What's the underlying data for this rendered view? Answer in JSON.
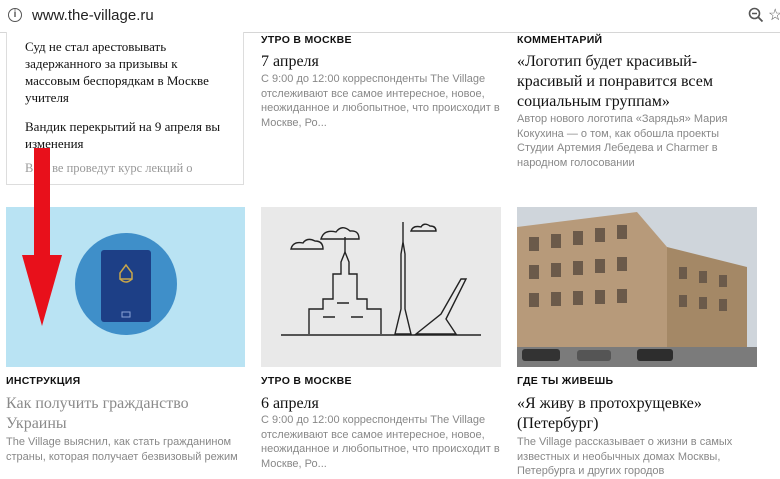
{
  "browser": {
    "url": "www.the-village.ru"
  },
  "news_list": {
    "items": [
      "Суд не стал арестовывать задержанного за призывы к массовым беспорядкам в Москве учителя",
      "Вандик перекрытий на 9 апреля вы изменения",
      "В … ве проведут курс лекций о"
    ]
  },
  "cards": [
    {
      "category": "УТРО В МОСКВЕ",
      "title": "7 апреля",
      "desc": "С 9:00 до 12:00 корреспонденты The Village отслеживают все самое интересное, новое, неожиданное и любопытное, что происходит в Москве, Ро..."
    },
    {
      "category": "КОММЕНТАРИЙ",
      "title": "«Логотип будет красивый-красивый и понравится всем социальным группам»",
      "desc": "Автор нового логотипа «Зарядья» Мария Кокухина — о том, как обошла проекты Студии Артемия Лебедева и Charmer в народном голосовании"
    },
    {
      "category": "ИНСТРУКЦИЯ",
      "title": "Как получить гражданство Украины",
      "desc": "The Village выяснил, как стать гражданином страны, которая получает безвизовый режим"
    },
    {
      "category": "УТРО В МОСКВЕ",
      "title": "6 апреля",
      "desc": "С 9:00 до 12:00 корреспонденты The Village отслеживают все самое интересное, новое, неожиданное и любопытное, что происходит в Москве, Ро..."
    },
    {
      "category": "ГДЕ ТЫ ЖИВЕШЬ",
      "title": "«Я живу в протохрущевке» (Петербург)",
      "desc": "The Village рассказывает о жизни в самых известных и необычных домах Москвы, Петербурга и других городов"
    }
  ],
  "colors": {
    "accent_arrow": "#e8101b",
    "passport_bg": "#b9e3f3",
    "passport_circle": "#3f8fc9",
    "passport": "#1d3f86"
  }
}
